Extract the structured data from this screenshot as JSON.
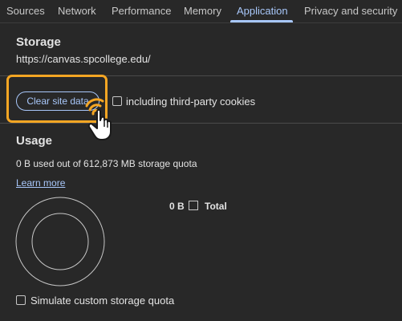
{
  "tabs": [
    {
      "label": "Sources"
    },
    {
      "label": "Network"
    },
    {
      "label": "Performance"
    },
    {
      "label": "Memory"
    },
    {
      "label": "Application",
      "active": true
    },
    {
      "label": "Privacy and security"
    }
  ],
  "storage": {
    "title": "Storage",
    "origin": "https://canvas.spcollege.edu/",
    "clear_button": "Clear site data",
    "third_party_checkbox": {
      "label": "including third-party cookies",
      "checked": false
    }
  },
  "usage": {
    "title": "Usage",
    "summary": "0 B used out of 612,873 MB storage quota",
    "learn_more": "Learn more",
    "legend": {
      "value": "0 B",
      "label": "Total"
    }
  },
  "simulate_quota": {
    "label": "Simulate custom storage quota",
    "checked": false
  },
  "colors": {
    "background": "#282828",
    "accent": "#a8c7fa",
    "highlight": "#f5a623"
  },
  "icons": {
    "cursor": "pointing-hand-click-icon"
  }
}
